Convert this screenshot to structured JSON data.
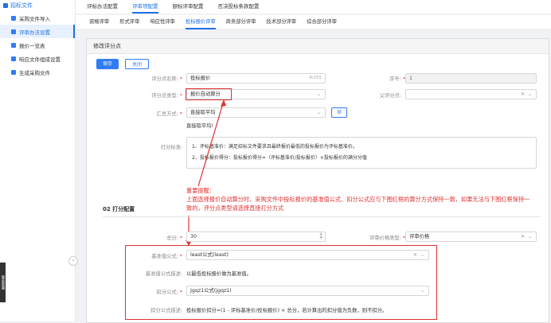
{
  "sidebar": {
    "header": "招标文件",
    "items": [
      {
        "label": "采购文件导入"
      },
      {
        "label": "评审办法设置"
      },
      {
        "label": "报价一览表"
      },
      {
        "label": "响应文件组成设置"
      },
      {
        "label": "生成采购文件"
      }
    ],
    "badge": "联系客服"
  },
  "top_tabs": [
    "评标办法配置",
    "评审项配置",
    "额标评审配置",
    "否决投标条款配置"
  ],
  "sub_tabs": [
    "资格评审",
    "形式评审",
    "响应性评审",
    "投标报价评审",
    "商务部分评审",
    "技术部分评审",
    "综合部分评审"
  ],
  "panel": {
    "title": "修改评分点",
    "save": "保存",
    "close": "关闭"
  },
  "form": {
    "name_label": "评分点名称:",
    "name_value": "投标报价",
    "name_count": "4/255",
    "seq_label": "序号:",
    "seq_value": "1",
    "type_label": "评分点类型:",
    "type_value": "报价自动算分",
    "parent_label": "父评分点:",
    "sum_label": "汇总方式:",
    "sum_value": "直接取平均",
    "sum_note": "直接取平均!",
    "std_label": "打分标准:",
    "std_line1": "1、评标基准价：满足招标文件要求且最终报价最低的投标报价为评标基准价。",
    "std_line2": "2、投标报价得分：投标报价得分=（评标基准价/投标报价）×投标报价的满分分值"
  },
  "annotation": {
    "title": "重要提醒：",
    "line1": "上面选择报价自动算分时，采购文件中投标报价的基准值公式、扣分公式应与下图红框的算分方式保持一致，如果无法与下图红框保持一",
    "line2": "致的，评分点类型请选择直接打分方式"
  },
  "section2": {
    "title": "02  打分配置",
    "total_label": "总分:",
    "total_value": "30",
    "price_type_label": "评审价格类型:",
    "price_type_value": "评审价格",
    "base_formula_label": "基准值公式:",
    "base_formula_value": "least公式(least)",
    "base_desc_label": "基准值公式描述:",
    "base_desc_value": "以最低投标报价做为基准值。",
    "deduct_label": "扣分公式:",
    "deduct_value": "Jgqz1公式(jgqz1)",
    "deduct_desc_label": "扣分公式描述:",
    "deduct_desc_value": "投标报价扣分=(1 - 评标基准价/投标报价) × 总分，若计算出的扣分值为负数，则不扣分。"
  },
  "colors": {
    "accent": "#2f7cf6",
    "alert": "#e03131"
  }
}
